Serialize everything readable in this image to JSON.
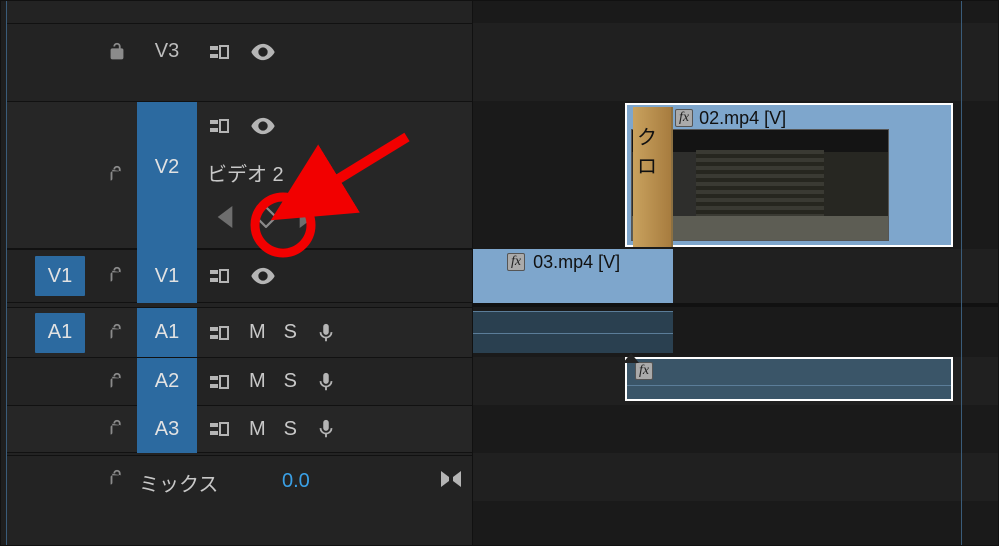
{
  "tracks": {
    "v3": {
      "label": "V3"
    },
    "v2": {
      "label": "V2",
      "name": "ビデオ 2"
    },
    "v1_src": {
      "label": "V1"
    },
    "v1": {
      "label": "V1"
    },
    "a1_src": {
      "label": "A1"
    },
    "a1": {
      "label": "A1"
    },
    "a2": {
      "label": "A2"
    },
    "a3": {
      "label": "A3"
    },
    "mix": {
      "label": "ミックス",
      "pan": "0.0"
    }
  },
  "buttons": {
    "M": "M",
    "S": "S"
  },
  "clips": {
    "video2": {
      "name": "02.mp4 [V]",
      "transition_label": "クロ"
    },
    "video1": {
      "name": "03.mp4 [V]"
    }
  }
}
